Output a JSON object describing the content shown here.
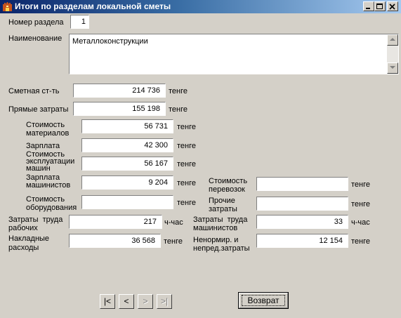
{
  "window": {
    "title": "Итоги по разделам локальной сметы"
  },
  "section_number": {
    "label": "Номер раздела",
    "value": "1"
  },
  "name": {
    "label": "Наименование",
    "value": "Металлоконструкции"
  },
  "estimated_cost": {
    "label": "Сметная ст-ть",
    "value": "214 736",
    "unit": "тенге"
  },
  "direct_costs": {
    "label": "Прямые затраты",
    "value": "155 198",
    "unit": "тенге"
  },
  "materials_cost": {
    "label": "Стоимость\nматериалов",
    "value": "56 731",
    "unit": "тенге"
  },
  "salary": {
    "label": "Зарплата",
    "value": "42 300",
    "unit": "тенге"
  },
  "machine_cost": {
    "label": "Стоимость\nэксплуатации\nмашин",
    "value": "56 167",
    "unit": "тенге"
  },
  "machinist_salary": {
    "label": "Зарплата\nмашинистов",
    "value": "9 204",
    "unit": "тенге"
  },
  "equipment_cost": {
    "label": "Стоимость\nоборудования",
    "value": "",
    "unit": "тенге"
  },
  "transport_cost": {
    "label": "Стоимость\nперевозок",
    "value": "",
    "unit": "тенге"
  },
  "other_costs": {
    "label": "Прочие\nзатраты",
    "value": "",
    "unit": "тенге"
  },
  "worker_labor": {
    "label": "Затраты  труда\nрабочих",
    "value": "217",
    "unit": "ч-час"
  },
  "machinist_labor": {
    "label": "Затраты  труда\nмашинистов",
    "value": "33",
    "unit": "ч-час"
  },
  "overhead": {
    "label": "Накладные\nрасходы",
    "value": "36 568",
    "unit": "тенге"
  },
  "unforeseen": {
    "label": "Ненормир. и\nнепред.затраты",
    "value": "12 154",
    "unit": "тенге"
  },
  "nav": {
    "first": "|<",
    "prev": "<",
    "next": ">",
    "last": ">|"
  },
  "back_button": "Возврат",
  "icons": {
    "app": "castle-icon",
    "minimize": "minimize-icon",
    "maximize": "maximize-icon",
    "close": "close-icon"
  }
}
